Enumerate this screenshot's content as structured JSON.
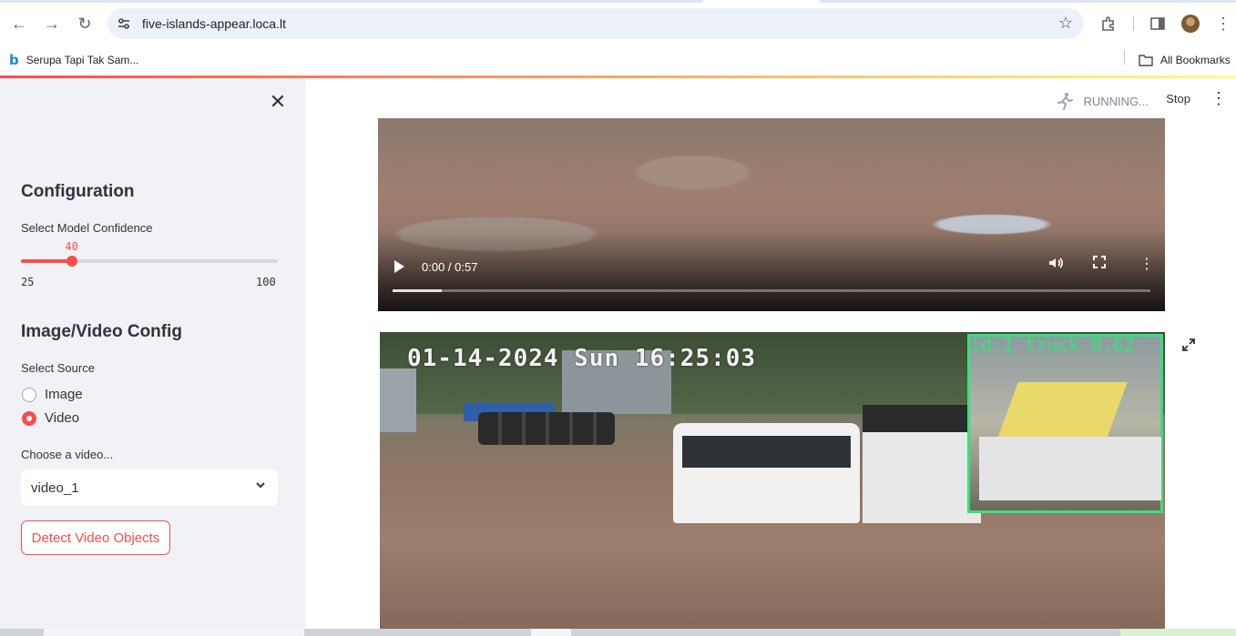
{
  "browser": {
    "url": "five-islands-appear.loca.lt",
    "bookmarks": [
      {
        "label": "Serupa Tapi Tak Sam..."
      }
    ],
    "all_bookmarks_label": "All Bookmarks"
  },
  "sidebar": {
    "config_heading": "Configuration",
    "confidence_label": "Select Model Confidence",
    "slider": {
      "value": "40",
      "min": "25",
      "max": "100",
      "fraction": 0.2
    },
    "media_heading": "Image/Video Config",
    "source_label": "Select Source",
    "source_options": [
      {
        "label": "Image",
        "selected": false
      },
      {
        "label": "Video",
        "selected": true
      }
    ],
    "video_label": "Choose a video...",
    "video_selected": "video_1",
    "detect_button": "Detect Video Objects"
  },
  "header": {
    "status": "RUNNING...",
    "stop": "Stop"
  },
  "video_player": {
    "time": "0:00 / 0:57",
    "buffered_fraction": 0.065
  },
  "detection_frame": {
    "timestamp_overlay": "01-14-2024 Sun 16:25:03",
    "detection_label": "id:1 truck 0.62"
  },
  "colors": {
    "accent": "#ff4b4b",
    "sidebar_bg": "#f0f2f6",
    "detection_box": "#36e07c"
  }
}
